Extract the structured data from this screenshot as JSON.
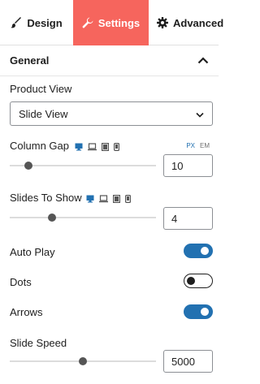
{
  "tabs": [
    {
      "label": "Design",
      "icon": "brush-icon",
      "active": false
    },
    {
      "label": "Settings",
      "icon": "wrench-icon",
      "active": true
    },
    {
      "label": "Advanced",
      "icon": "gear-icon",
      "active": false
    }
  ],
  "section": {
    "title": "General",
    "expanded": true
  },
  "product_view": {
    "label": "Product View",
    "value": "Slide View"
  },
  "column_gap": {
    "label": "Column Gap",
    "value": "10",
    "slider_fraction": 0.13,
    "units": [
      "PX",
      "EM"
    ],
    "active_unit": "PX"
  },
  "slides_to_show": {
    "label": "Slides To Show",
    "value": "4",
    "slider_fraction": 0.29
  },
  "auto_play": {
    "label": "Auto Play",
    "on": true
  },
  "dots": {
    "label": "Dots",
    "on": false
  },
  "arrows": {
    "label": "Arrows",
    "on": true
  },
  "slide_speed": {
    "label": "Slide Speed",
    "value": "5000",
    "slider_fraction": 0.5
  },
  "colors": {
    "accent": "#2271b1",
    "active_tab": "#f6655d"
  }
}
